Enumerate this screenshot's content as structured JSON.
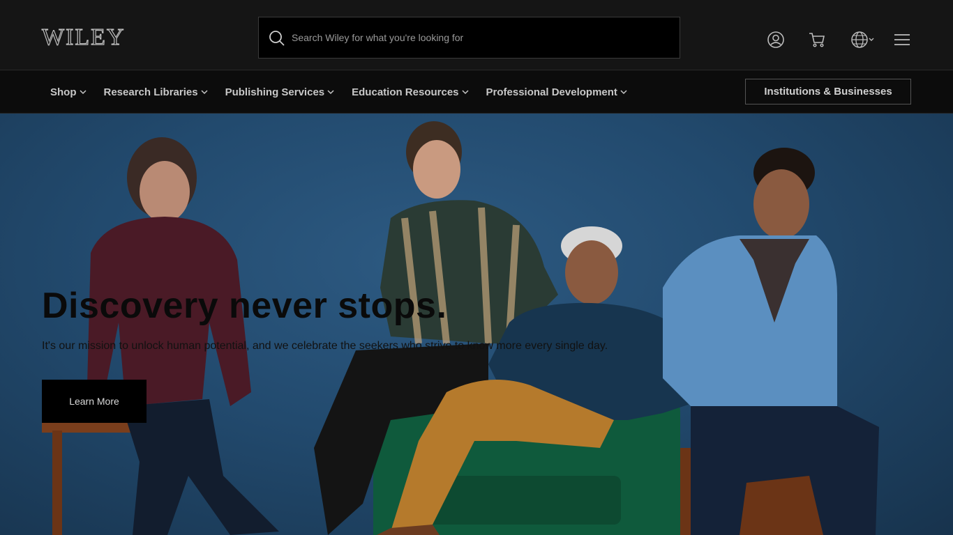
{
  "header": {
    "logo": "WILEY",
    "search": {
      "placeholder": "Search Wiley for what you're looking for",
      "value": ""
    },
    "icons": [
      "account-icon",
      "cart-icon",
      "globe-language-icon",
      "menu-icon"
    ]
  },
  "nav": {
    "items": [
      {
        "label": "Shop"
      },
      {
        "label": "Research Libraries"
      },
      {
        "label": "Publishing Services"
      },
      {
        "label": "Education Resources"
      },
      {
        "label": "Professional Development"
      }
    ],
    "institutions_button": "Institutions & Businesses"
  },
  "hero": {
    "title": "Discovery never stops.",
    "subtitle": "It's our mission to unlock human potential, and we celebrate the seekers who strive to know more every single day.",
    "cta": "Learn More"
  },
  "colors": {
    "header_bg": "#151515",
    "nav_bg": "#0c0c0c",
    "hero_bg": "#224a6e",
    "cta_bg": "#000000"
  }
}
